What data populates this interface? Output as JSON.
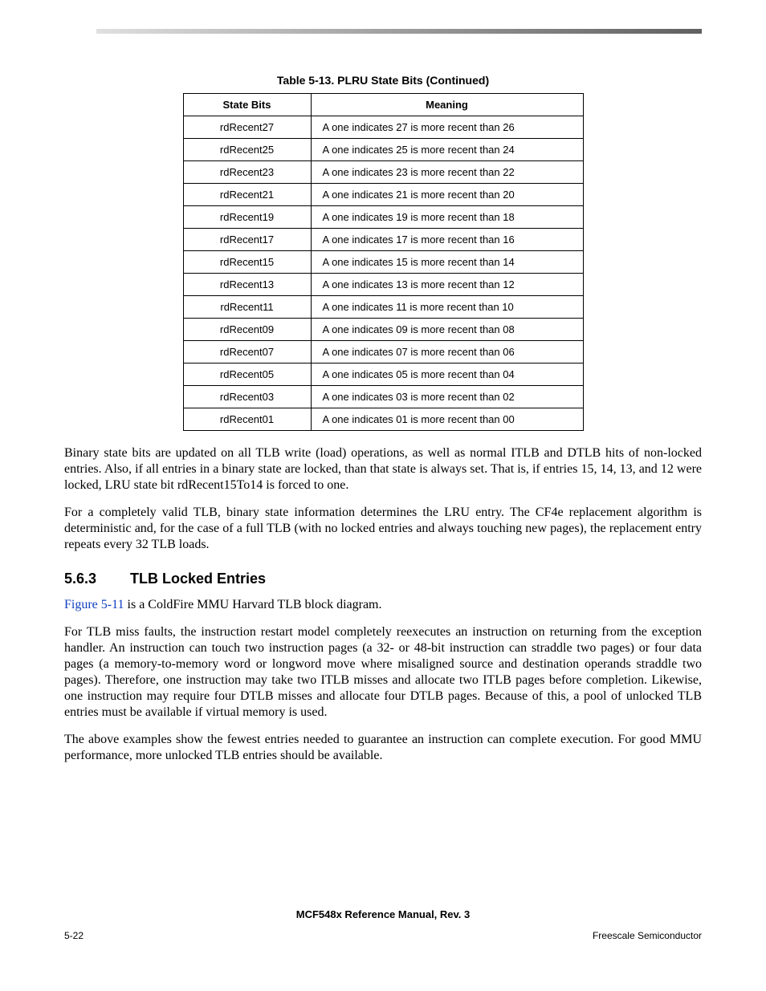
{
  "table": {
    "caption": "Table 5-13. PLRU State Bits (Continued)",
    "headers": {
      "col1": "State Bits",
      "col2": "Meaning"
    },
    "rows": [
      {
        "state": "rdRecent27",
        "meaning": "A one indicates 27 is more recent than 26"
      },
      {
        "state": "rdRecent25",
        "meaning": "A one indicates 25 is more recent than 24"
      },
      {
        "state": "rdRecent23",
        "meaning": "A one indicates 23 is more recent than 22"
      },
      {
        "state": "rdRecent21",
        "meaning": "A one indicates 21 is more recent than 20"
      },
      {
        "state": "rdRecent19",
        "meaning": "A one indicates 19 is more recent than 18"
      },
      {
        "state": "rdRecent17",
        "meaning": "A one indicates 17 is more recent than 16"
      },
      {
        "state": "rdRecent15",
        "meaning": "A one indicates 15 is more recent than 14"
      },
      {
        "state": "rdRecent13",
        "meaning": "A one indicates 13 is more recent than 12"
      },
      {
        "state": "rdRecent11",
        "meaning": "A one indicates 11 is more recent than 10"
      },
      {
        "state": "rdRecent09",
        "meaning": "A one indicates 09 is more recent than 08"
      },
      {
        "state": "rdRecent07",
        "meaning": "A one indicates 07 is more recent than 06"
      },
      {
        "state": "rdRecent05",
        "meaning": "A one indicates 05 is more recent than 04"
      },
      {
        "state": "rdRecent03",
        "meaning": "A one indicates 03 is more recent than 02"
      },
      {
        "state": "rdRecent01",
        "meaning": "A one indicates 01 is more recent than 00"
      }
    ]
  },
  "paragraphs": {
    "p1": "Binary state bits are updated on all TLB write (load) operations, as well as normal ITLB and DTLB hits of non-locked entries. Also, if all entries in a binary state are locked, than that state is always set. That is, if entries 15, 14, 13, and 12 were locked, LRU state bit rdRecent15To14 is forced to one.",
    "p2": "For a completely valid TLB, binary state information determines the LRU entry. The CF4e replacement algorithm is deterministic and, for the case of a full TLB (with no locked entries and always touching new pages), the replacement entry repeats every 32 TLB loads.",
    "p3_xref": "Figure 5-11",
    "p3_rest": " is a ColdFire MMU Harvard TLB block diagram.",
    "p4": "For TLB miss faults, the instruction restart model completely reexecutes an instruction on returning from the exception handler. An instruction can touch two instruction pages (a 32- or 48-bit instruction can straddle two pages) or four data pages (a memory-to-memory word or longword move where misaligned source and destination operands straddle two pages). Therefore, one instruction may take two ITLB misses and allocate two ITLB pages before completion. Likewise, one instruction may require four DTLB misses and allocate four DTLB pages. Because of this, a pool of unlocked TLB entries must be available if virtual memory is used.",
    "p5": "The above examples show the fewest entries needed to guarantee an instruction can complete execution. For good MMU performance, more unlocked TLB entries should be available."
  },
  "section": {
    "number": "5.6.3",
    "title": "TLB Locked Entries"
  },
  "footer": {
    "center": "MCF548x Reference Manual, Rev. 3",
    "left": "5-22",
    "right": "Freescale Semiconductor"
  }
}
